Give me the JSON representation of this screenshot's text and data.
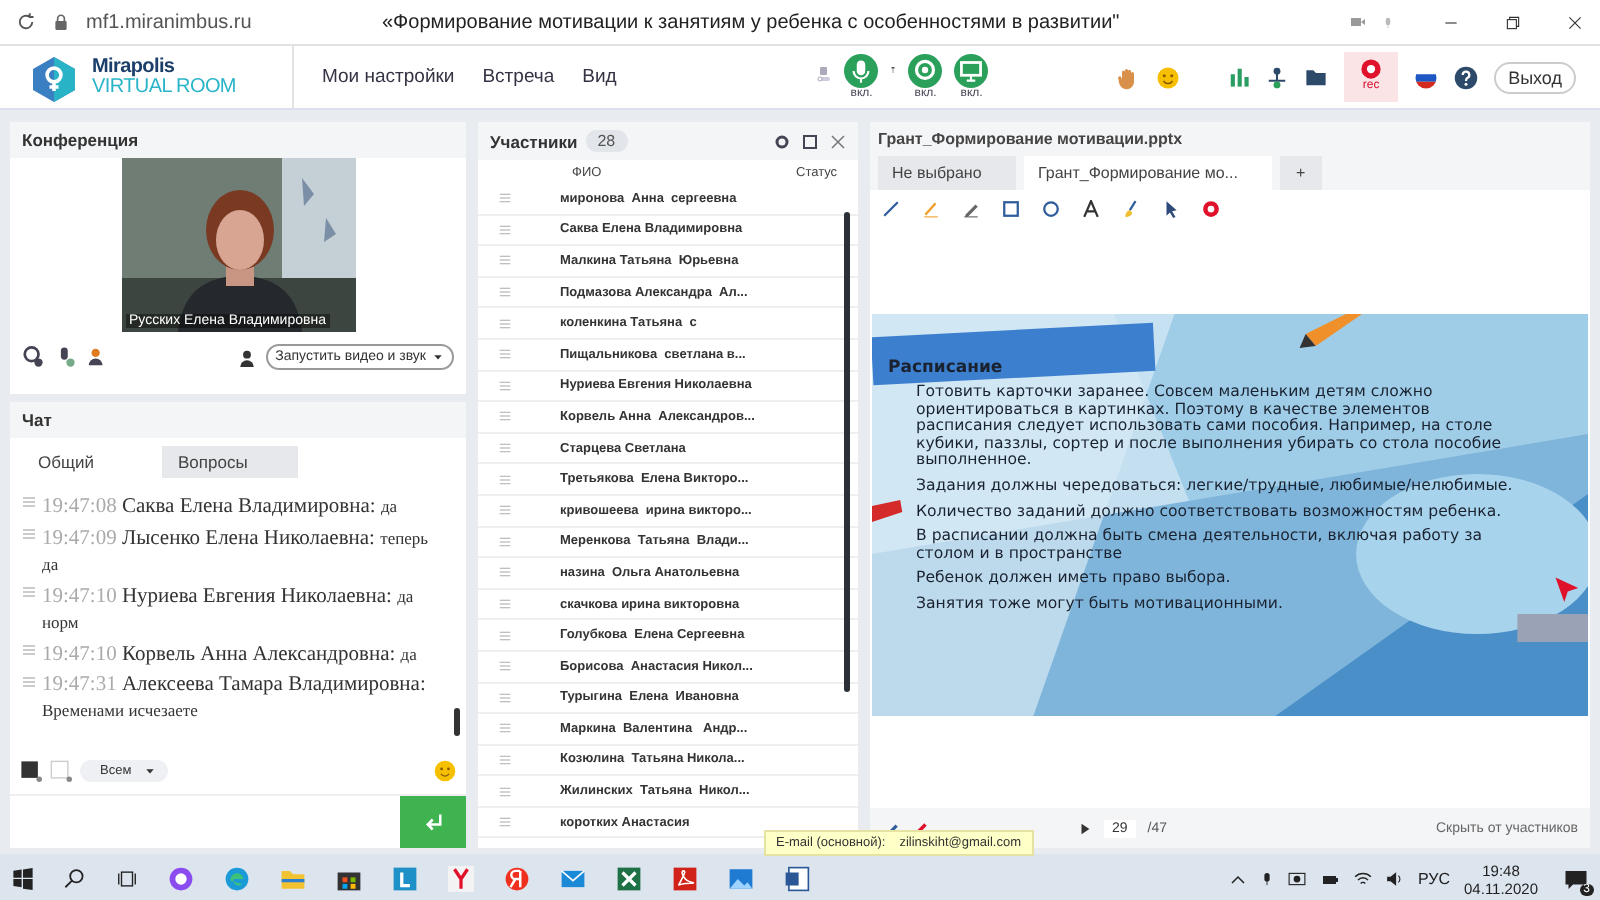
{
  "browser": {
    "url": "mf1.miranimbus.ru",
    "title": "«Формирование мотивации к занятиям у ребенка с особенностями в развитии\""
  },
  "app": {
    "logo_top": "Mirapolis",
    "logo_bottom": "VIRTUAL ROOM",
    "menu": [
      "Мои настройки",
      "Встреча",
      "Вид"
    ],
    "media": [
      {
        "kind": "mic",
        "label": "вкл.",
        "on": true
      },
      {
        "kind": "camera",
        "label": "вкл.",
        "on": true
      },
      {
        "kind": "screen",
        "label": "вкл.",
        "on": true
      }
    ],
    "rec_label": "rec",
    "exit": "Выход"
  },
  "conference": {
    "title": "Конференция",
    "video_name": "Русских Елена Владимировна",
    "start_button": "Запустить видео и звук"
  },
  "chat": {
    "title": "Чат",
    "tabs": [
      {
        "label": "Общий",
        "selected": true
      },
      {
        "label": "Вопросы",
        "selected": false
      }
    ],
    "messages": [
      {
        "time": "19:47:08",
        "author": "Саква Елена Владимировна:",
        "text": "да"
      },
      {
        "time": "19:47:09",
        "author": "Лысенко Елена  Николаевна:",
        "text": "теперь да"
      },
      {
        "time": "19:47:10",
        "author": "Нуриева Евгения Николаевна:",
        "text": "да норм"
      },
      {
        "time": "19:47:10",
        "author": "Корвель Анна  Александровна:",
        "text": "да"
      },
      {
        "time": "19:47:31",
        "author": "Алексеева   Тамара Владимировна:",
        "text": "Временами исчезаете"
      }
    ],
    "recipient": "Всем"
  },
  "participants": {
    "title": "Участники",
    "count": "28",
    "columns": [
      "ФИО",
      "Статус"
    ],
    "rows": [
      "миронова  Анна  сергеевна",
      "Саква Елена Владимировна",
      "Малкина Татьяна  Юрьевна",
      "Подмазова Александра  Ал...",
      "коленкина Татьяна  с",
      "Пищальникова  светлана в...",
      "Нуриева Евгения Николаевна",
      "Корвель Анна  Александров...",
      "Старцева Светлана",
      "Третьякова  Елена Викторо...",
      "кривошеева  ирина викторо...",
      "Меренкова  Татьяна  Влади...",
      "назина  Ольга Анатольевна",
      "скачкова ирина викторовна",
      "Голубкова  Елена Сергеевна",
      "Борисова  Анастасия Никол...",
      "Турыгина  Елена  Ивановна",
      "Маркина  Валентина   Андр...",
      "Козюлина  Татьяна Никола...",
      "Жилинских  Татьяна  Никол...",
      "коротких Анастасия"
    ]
  },
  "presentation": {
    "title": "Грант_Формирование мотивации.pptx",
    "tabs": [
      {
        "label": "Не выбрано",
        "selected": false
      },
      {
        "label": "Грант_Формирование мо...",
        "selected": true
      }
    ],
    "add_tab": "+",
    "slide": {
      "title": "Расписание",
      "paragraphs": [
        "Готовить карточки заранее. Совсем маленьким детям сложно ориентироваться в картинках. Поэтому в качестве элементов расписания следует использовать сами пособия. Например, на столе кубики, паззлы, сортер и после выполнения убирать со стола пособие  выполненное.",
        "Задания должны чередоваться: легкие/трудные, любимые/нелюбимые.",
        "Количество заданий должно соответствовать возможностям ребенка.",
        "В расписании должна быть смена деятельности, включая работу за столом и в пространстве",
        "Ребенок должен иметь право выбора.",
        "Занятия тоже могут быть мотивационными."
      ]
    },
    "page": "29",
    "total": "/47",
    "hide_button": "Скрыть от участников"
  },
  "tooltip": {
    "label": "E-mail (основной):",
    "value": "zilinskiht@gmail.com"
  },
  "taskbar": {
    "language": "РУС",
    "time": "19:48",
    "date": "04.11.2020",
    "notifications": "3"
  }
}
